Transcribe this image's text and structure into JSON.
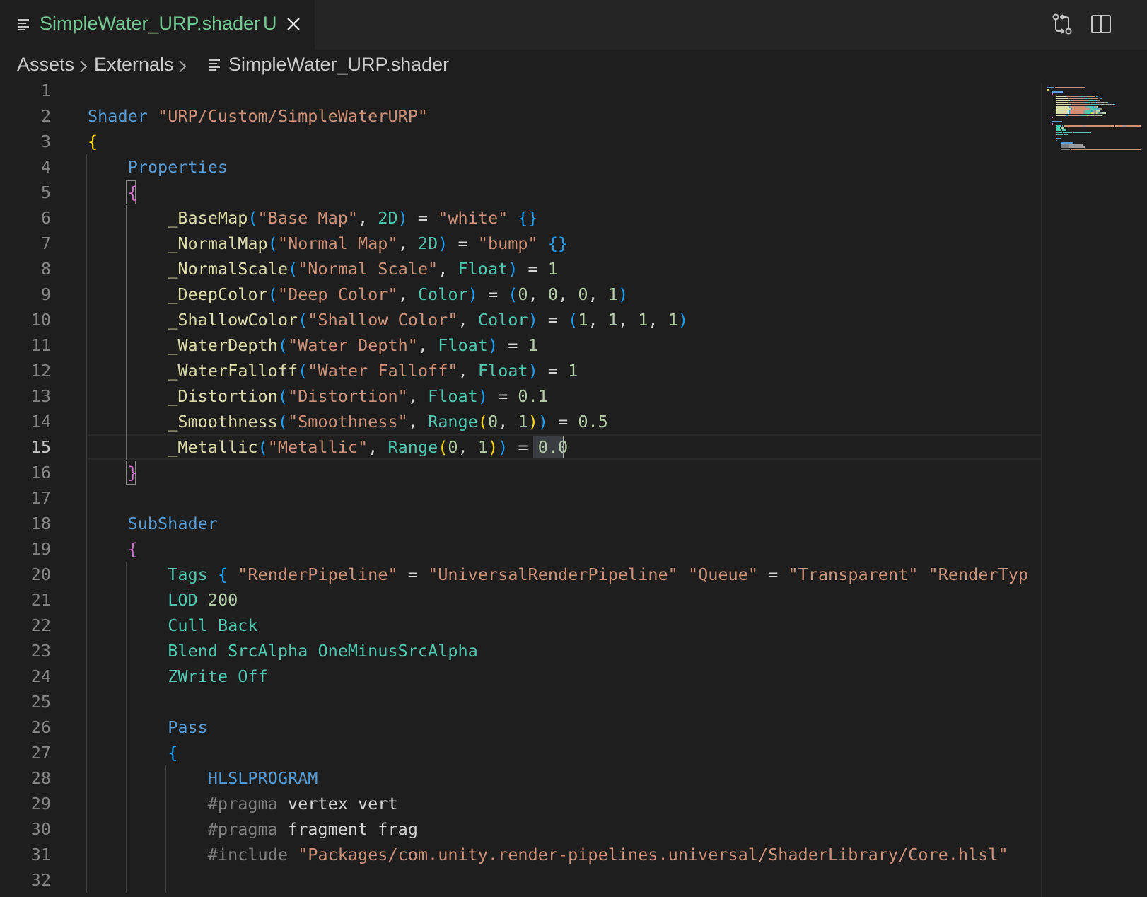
{
  "tab": {
    "title": "SimpleWater_URP.shader",
    "status": "U"
  },
  "breadcrumb": {
    "items": [
      "Assets",
      "Externals",
      "SimpleWater_URP.shader"
    ]
  },
  "editor": {
    "active_line": 15,
    "line_numbers": [
      "1",
      "2",
      "3",
      "4",
      "5",
      "6",
      "7",
      "8",
      "9",
      "10",
      "11",
      "12",
      "13",
      "14",
      "15",
      "16",
      "17",
      "18",
      "19",
      "20",
      "21",
      "22",
      "23",
      "24",
      "25",
      "26",
      "27",
      "28",
      "29",
      "30",
      "31",
      "32"
    ],
    "lines": [
      [],
      [
        [
          "k",
          "Shader"
        ],
        [
          "w",
          " "
        ],
        [
          "s",
          "\"URP/Custom/SimpleWaterURP\""
        ]
      ],
      [
        [
          "b1",
          "{"
        ]
      ],
      [
        [
          "w",
          "    "
        ],
        [
          "k",
          "Properties"
        ]
      ],
      [
        [
          "w",
          "    "
        ],
        [
          "b2",
          "{"
        ]
      ],
      [
        [
          "w",
          "        "
        ],
        [
          "f",
          "_BaseMap"
        ],
        [
          "b3",
          "("
        ],
        [
          "s",
          "\"Base Map\""
        ],
        [
          "p",
          ", "
        ],
        [
          "t",
          "2D"
        ],
        [
          "b3",
          ")"
        ],
        [
          "p",
          " = "
        ],
        [
          "s",
          "\"white\""
        ],
        [
          "p",
          " "
        ],
        [
          "b3",
          "{}"
        ]
      ],
      [
        [
          "w",
          "        "
        ],
        [
          "f",
          "_NormalMap"
        ],
        [
          "b3",
          "("
        ],
        [
          "s",
          "\"Normal Map\""
        ],
        [
          "p",
          ", "
        ],
        [
          "t",
          "2D"
        ],
        [
          "b3",
          ")"
        ],
        [
          "p",
          " = "
        ],
        [
          "s",
          "\"bump\""
        ],
        [
          "p",
          " "
        ],
        [
          "b3",
          "{}"
        ]
      ],
      [
        [
          "w",
          "        "
        ],
        [
          "f",
          "_NormalScale"
        ],
        [
          "b3",
          "("
        ],
        [
          "s",
          "\"Normal Scale\""
        ],
        [
          "p",
          ", "
        ],
        [
          "t",
          "Float"
        ],
        [
          "b3",
          ")"
        ],
        [
          "p",
          " = "
        ],
        [
          "n",
          "1"
        ]
      ],
      [
        [
          "w",
          "        "
        ],
        [
          "f",
          "_DeepColor"
        ],
        [
          "b3",
          "("
        ],
        [
          "s",
          "\"Deep Color\""
        ],
        [
          "p",
          ", "
        ],
        [
          "t",
          "Color"
        ],
        [
          "b3",
          ")"
        ],
        [
          "p",
          " = "
        ],
        [
          "b3",
          "("
        ],
        [
          "n",
          "0"
        ],
        [
          "p",
          ", "
        ],
        [
          "n",
          "0"
        ],
        [
          "p",
          ", "
        ],
        [
          "n",
          "0"
        ],
        [
          "p",
          ", "
        ],
        [
          "n",
          "1"
        ],
        [
          "b3",
          ")"
        ]
      ],
      [
        [
          "w",
          "        "
        ],
        [
          "f",
          "_ShallowColor"
        ],
        [
          "b3",
          "("
        ],
        [
          "s",
          "\"Shallow Color\""
        ],
        [
          "p",
          ", "
        ],
        [
          "t",
          "Color"
        ],
        [
          "b3",
          ")"
        ],
        [
          "p",
          " = "
        ],
        [
          "b3",
          "("
        ],
        [
          "n",
          "1"
        ],
        [
          "p",
          ", "
        ],
        [
          "n",
          "1"
        ],
        [
          "p",
          ", "
        ],
        [
          "n",
          "1"
        ],
        [
          "p",
          ", "
        ],
        [
          "n",
          "1"
        ],
        [
          "b3",
          ")"
        ]
      ],
      [
        [
          "w",
          "        "
        ],
        [
          "f",
          "_WaterDepth"
        ],
        [
          "b3",
          "("
        ],
        [
          "s",
          "\"Water Depth\""
        ],
        [
          "p",
          ", "
        ],
        [
          "t",
          "Float"
        ],
        [
          "b3",
          ")"
        ],
        [
          "p",
          " = "
        ],
        [
          "n",
          "1"
        ]
      ],
      [
        [
          "w",
          "        "
        ],
        [
          "f",
          "_WaterFalloff"
        ],
        [
          "b3",
          "("
        ],
        [
          "s",
          "\"Water Falloff\""
        ],
        [
          "p",
          ", "
        ],
        [
          "t",
          "Float"
        ],
        [
          "b3",
          ")"
        ],
        [
          "p",
          " = "
        ],
        [
          "n",
          "1"
        ]
      ],
      [
        [
          "w",
          "        "
        ],
        [
          "f",
          "_Distortion"
        ],
        [
          "b3",
          "("
        ],
        [
          "s",
          "\"Distortion\""
        ],
        [
          "p",
          ", "
        ],
        [
          "t",
          "Float"
        ],
        [
          "b3",
          ")"
        ],
        [
          "p",
          " = "
        ],
        [
          "n",
          "0.1"
        ]
      ],
      [
        [
          "w",
          "        "
        ],
        [
          "f",
          "_Smoothness"
        ],
        [
          "b3",
          "("
        ],
        [
          "s",
          "\"Smoothness\""
        ],
        [
          "p",
          ", "
        ],
        [
          "t",
          "Range"
        ],
        [
          "b1",
          "("
        ],
        [
          "n",
          "0"
        ],
        [
          "p",
          ", "
        ],
        [
          "n",
          "1"
        ],
        [
          "b1",
          ")"
        ],
        [
          "b3",
          ")"
        ],
        [
          "p",
          " = "
        ],
        [
          "n",
          "0.5"
        ]
      ],
      [
        [
          "w",
          "        "
        ],
        [
          "f",
          "_Metallic"
        ],
        [
          "b3",
          "("
        ],
        [
          "s",
          "\"Metallic\""
        ],
        [
          "p",
          ", "
        ],
        [
          "t",
          "Range"
        ],
        [
          "b1",
          "("
        ],
        [
          "n",
          "0"
        ],
        [
          "p",
          ", "
        ],
        [
          "n",
          "1"
        ],
        [
          "b1",
          ")"
        ],
        [
          "b3",
          ")"
        ],
        [
          "p",
          " = "
        ],
        [
          "n",
          "0.0"
        ]
      ],
      [
        [
          "w",
          "    "
        ],
        [
          "b2",
          "}"
        ]
      ],
      [],
      [
        [
          "w",
          "    "
        ],
        [
          "k",
          "SubShader"
        ]
      ],
      [
        [
          "w",
          "    "
        ],
        [
          "b2",
          "{"
        ]
      ],
      [
        [
          "w",
          "        "
        ],
        [
          "t",
          "Tags"
        ],
        [
          "p",
          " "
        ],
        [
          "b3",
          "{"
        ],
        [
          "p",
          " "
        ],
        [
          "s",
          "\"RenderPipeline\""
        ],
        [
          "p",
          " = "
        ],
        [
          "s",
          "\"UniversalRenderPipeline\""
        ],
        [
          "p",
          " "
        ],
        [
          "s",
          "\"Queue\""
        ],
        [
          "p",
          " = "
        ],
        [
          "s",
          "\"Transparent\""
        ],
        [
          "p",
          " "
        ],
        [
          "s",
          "\"RenderTyp"
        ]
      ],
      [
        [
          "w",
          "        "
        ],
        [
          "t",
          "LOD"
        ],
        [
          "p",
          " "
        ],
        [
          "n",
          "200"
        ]
      ],
      [
        [
          "w",
          "        "
        ],
        [
          "t",
          "Cull"
        ],
        [
          "p",
          " "
        ],
        [
          "t",
          "Back"
        ]
      ],
      [
        [
          "w",
          "        "
        ],
        [
          "t",
          "Blend"
        ],
        [
          "p",
          " "
        ],
        [
          "t",
          "SrcAlpha"
        ],
        [
          "p",
          " "
        ],
        [
          "t",
          "OneMinusSrcAlpha"
        ]
      ],
      [
        [
          "w",
          "        "
        ],
        [
          "t",
          "ZWrite"
        ],
        [
          "p",
          " "
        ],
        [
          "t",
          "Off"
        ]
      ],
      [],
      [
        [
          "w",
          "        "
        ],
        [
          "k",
          "Pass"
        ]
      ],
      [
        [
          "w",
          "        "
        ],
        [
          "b3",
          "{"
        ]
      ],
      [
        [
          "w",
          "            "
        ],
        [
          "k",
          "HLSLPROGRAM"
        ]
      ],
      [
        [
          "w",
          "            "
        ],
        [
          "c",
          "#pragma"
        ],
        [
          "p",
          " vertex vert"
        ]
      ],
      [
        [
          "w",
          "            "
        ],
        [
          "c",
          "#pragma"
        ],
        [
          "p",
          " fragment frag"
        ]
      ],
      [
        [
          "w",
          "            "
        ],
        [
          "c",
          "#include"
        ],
        [
          "p",
          " "
        ],
        [
          "s",
          "\"Packages/com.unity.render-pipelines.universal/ShaderLibrary/Core.hlsl\""
        ]
      ],
      []
    ]
  },
  "colors": {
    "keyword": "#569cd6",
    "string": "#ce9178",
    "number": "#b5cea8",
    "type": "#4ec9b0",
    "function": "#dcdcaa",
    "tab_modified": "#73c991"
  }
}
